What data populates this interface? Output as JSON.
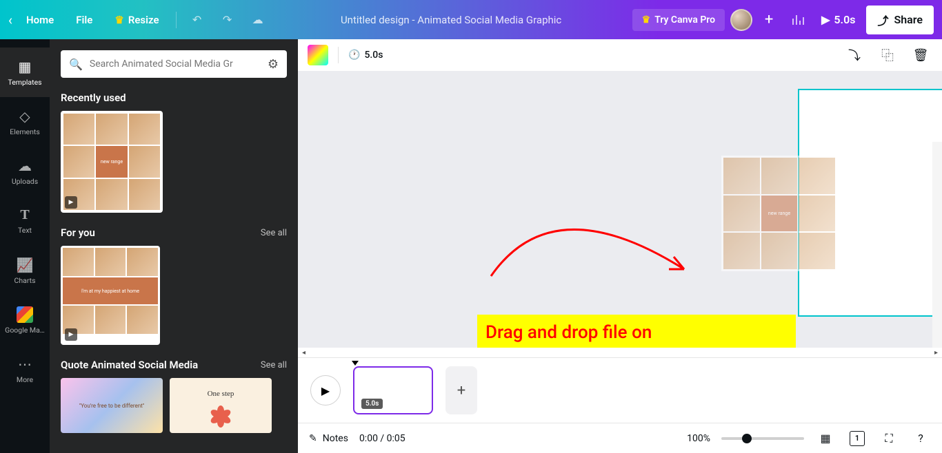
{
  "topbar": {
    "home": "Home",
    "file": "File",
    "resize": "Resize",
    "title": "Untitled design - Animated Social Media Graphic",
    "try_pro": "Try Canva Pro",
    "duration": "5.0s",
    "share": "Share"
  },
  "rail": {
    "templates": "Templates",
    "elements": "Elements",
    "uploads": "Uploads",
    "text": "Text",
    "charts": "Charts",
    "gmaps": "Google Ma…",
    "more": "More"
  },
  "panel": {
    "search_placeholder": "Search Animated Social Media Gr",
    "recently_used": "Recently used",
    "for_you": "For you",
    "see_all": "See all",
    "quote_section": "Quote Animated Social Media",
    "new_range": "new range",
    "happiest": "I'm at my happiest at home",
    "quote1": "\"You're free to be different\"",
    "quote2": "One step"
  },
  "context_bar": {
    "duration": "5.0s"
  },
  "annotation": "Drag and drop file on",
  "timeline": {
    "badge": "5.0s"
  },
  "bottom": {
    "notes": "Notes",
    "time": "0:00 / 0:05",
    "zoom": "100%",
    "page": "1"
  }
}
